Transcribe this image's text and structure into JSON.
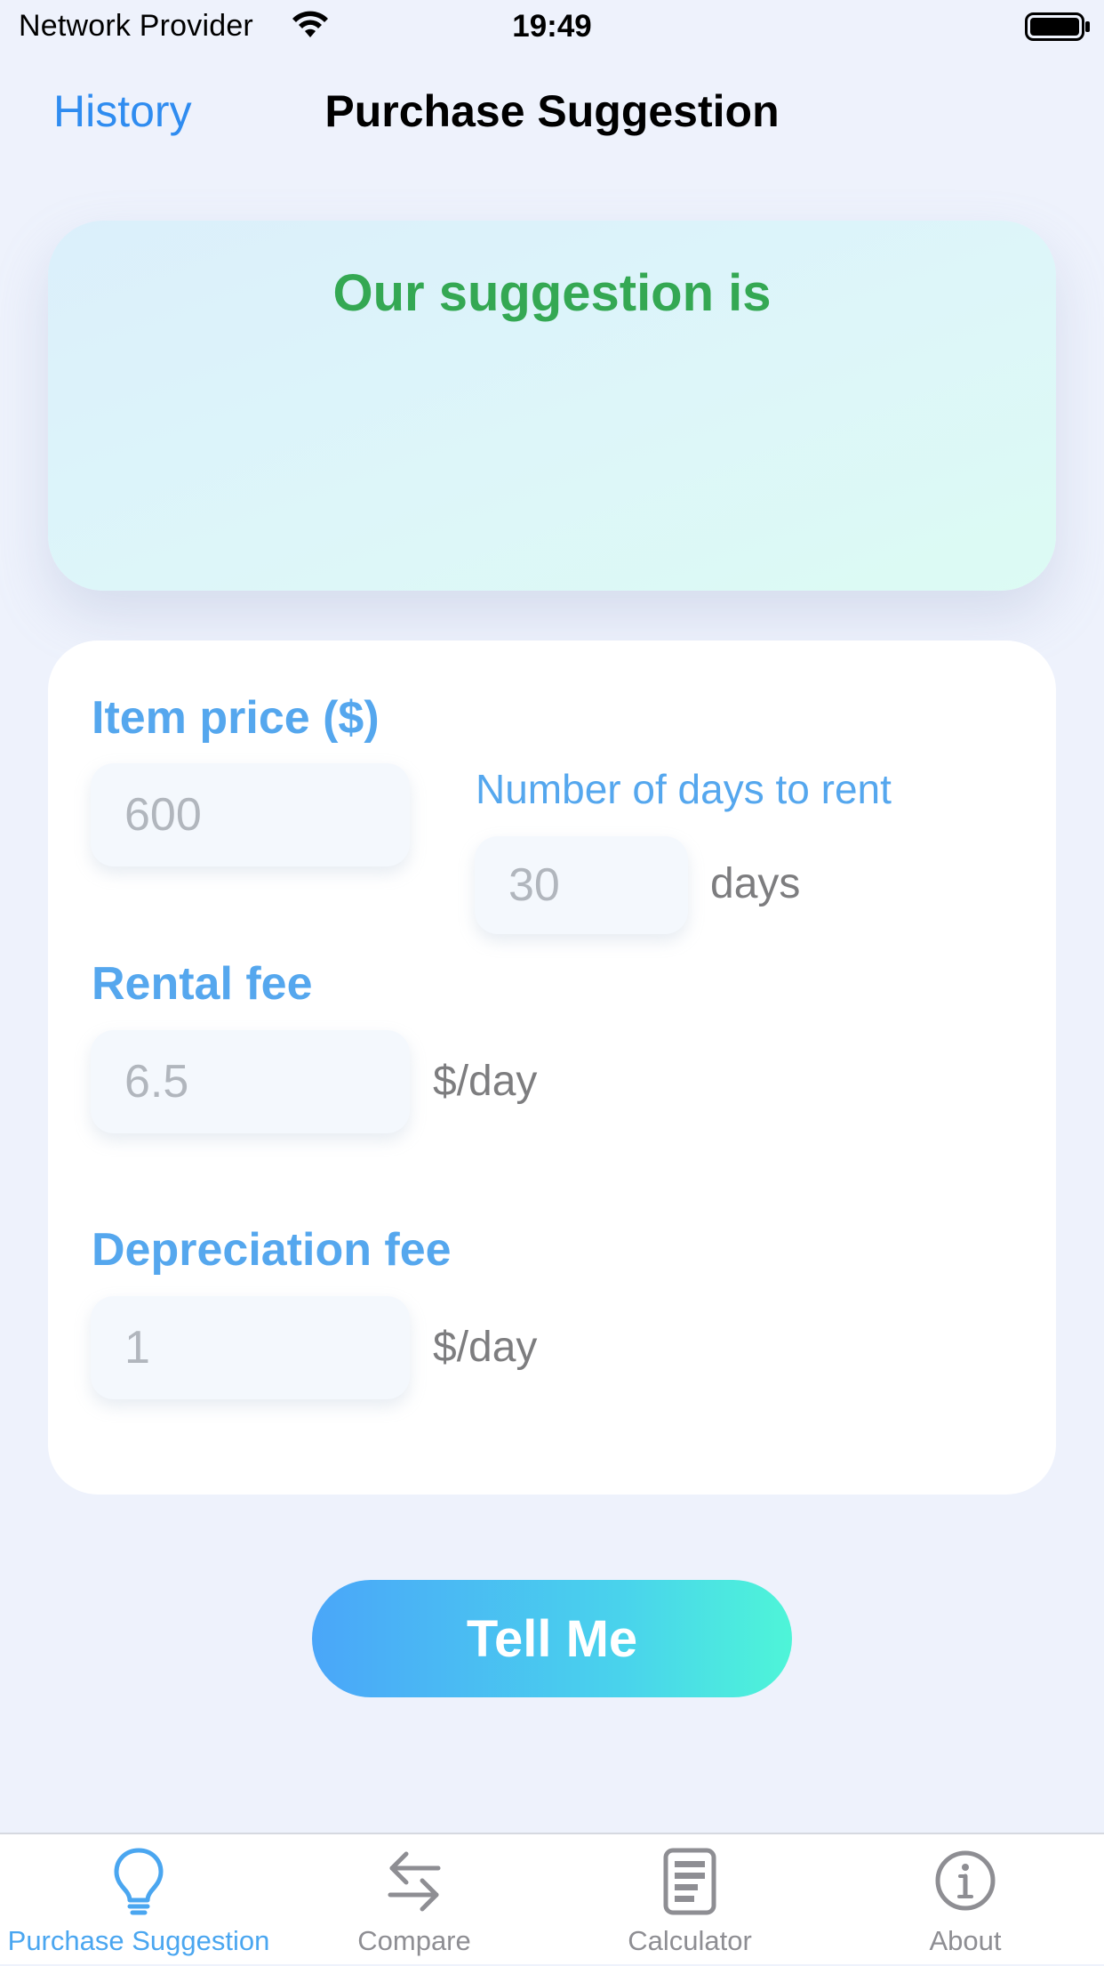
{
  "status_bar": {
    "carrier": "Network Provider",
    "time": "19:49",
    "icons": [
      "wifi-icon",
      "battery-icon"
    ]
  },
  "nav": {
    "back_label": "History",
    "title": "Purchase Suggestion"
  },
  "suggestion": {
    "heading": "Our suggestion is",
    "result": ""
  },
  "form": {
    "item_price": {
      "label": "Item price ($)",
      "placeholder": "600"
    },
    "rent_days": {
      "label": "Number of days to rent",
      "placeholder": "30",
      "unit": "days"
    },
    "rental_fee": {
      "label": "Rental fee",
      "placeholder": "6.5",
      "unit": "$/day"
    },
    "depreciation_fee": {
      "label": "Depreciation fee",
      "placeholder": "1",
      "unit": "$/day"
    }
  },
  "submit_label": "Tell Me",
  "tabs": [
    {
      "label": "Purchase Suggestion",
      "icon": "lightbulb-icon",
      "active": true
    },
    {
      "label": "Compare",
      "icon": "swap-arrows-icon",
      "active": false
    },
    {
      "label": "Calculator",
      "icon": "calculator-icon",
      "active": false
    },
    {
      "label": "About",
      "icon": "info-icon",
      "active": false
    }
  ],
  "colors": {
    "accent_blue": "#2f8cf0",
    "label_blue": "#55a7ee",
    "suggestion_green": "#34a853",
    "button_gradient_start": "#4aa6f9",
    "button_gradient_end": "#4ef5d8",
    "tab_active": "#4aa6f0",
    "tab_inactive": "#8e8e93"
  }
}
